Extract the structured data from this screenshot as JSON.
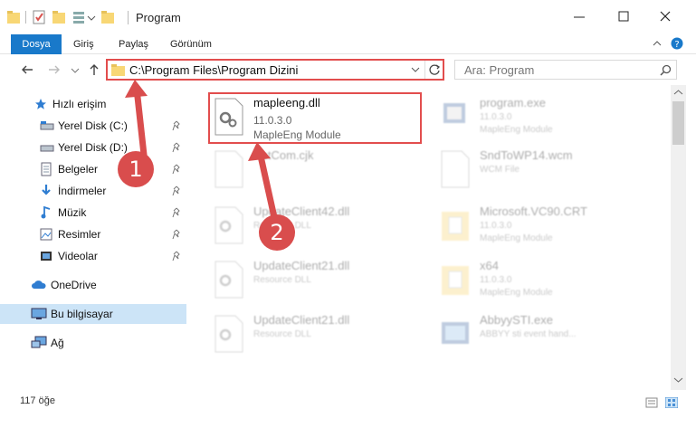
{
  "window": {
    "title": "Program"
  },
  "ribbon": {
    "tabs": [
      "Dosya",
      "Giriş",
      "Paylaş",
      "Görünüm"
    ]
  },
  "address": {
    "path": "C:\\Program Files\\Program Dizini",
    "search_placeholder": "Ara: Program"
  },
  "sidebar": {
    "items": [
      {
        "label": "Hızlı erişim",
        "icon": "star-icon"
      },
      {
        "label": "Yerel Disk (C:)",
        "icon": "drive-icon"
      },
      {
        "label": "Yerel Disk (D:)",
        "icon": "drive-icon"
      },
      {
        "label": "Belgeler",
        "icon": "documents-icon"
      },
      {
        "label": "İndirmeler",
        "icon": "download-icon"
      },
      {
        "label": "Müzik",
        "icon": "music-icon"
      },
      {
        "label": "Resimler",
        "icon": "pictures-icon"
      },
      {
        "label": "Videolar",
        "icon": "videos-icon"
      },
      {
        "label": "OneDrive",
        "icon": "cloud-icon"
      },
      {
        "label": "Bu bilgisayar",
        "icon": "computer-icon"
      },
      {
        "label": "Ağ",
        "icon": "network-icon"
      }
    ]
  },
  "files": [
    {
      "name": "mapleeng.dll",
      "line2": "11.0.3.0",
      "line3": "MapleEng Module",
      "icon": "gear-file-icon"
    },
    {
      "name": "program.exe",
      "line2": "11.0.3.0",
      "line3": "MapleEng Module",
      "icon": "exe-icon"
    },
    {
      "name": "HstCom.cjk",
      "line2": "",
      "line3": "",
      "icon": "blank-file-icon"
    },
    {
      "name": "SndToWP14.wcm",
      "line2": "WCM File",
      "line3": "",
      "icon": "blank-file-icon"
    },
    {
      "name": "UpdateClient42.dll",
      "line2": "Resource DLL",
      "line3": "",
      "icon": "gear-file-icon"
    },
    {
      "name": "Microsoft.VC90.CRT",
      "line2": "11.0.3.0",
      "line3": "MapleEng Module",
      "icon": "folder-file-icon"
    },
    {
      "name": "UpdateClient21.dll",
      "line2": "Resource DLL",
      "line3": "",
      "icon": "gear-file-icon"
    },
    {
      "name": "x64",
      "line2": "11.0.3.0",
      "line3": "MapleEng Module",
      "icon": "folder-file-icon"
    },
    {
      "name": "UpdateClient21.dll",
      "line2": "Resource DLL",
      "line3": "",
      "icon": "gear-file-icon"
    },
    {
      "name": "AbbyySTI.exe",
      "line2": "ABBYY sti event hand...",
      "line3": "",
      "icon": "exe-icon"
    }
  ],
  "status": {
    "count": "117 öğe"
  },
  "annotations": {
    "step1": "1",
    "step2": "2"
  },
  "colors": {
    "accent": "#1979ca",
    "annotation": "#d94d4d",
    "selected": "#cce4f7"
  }
}
